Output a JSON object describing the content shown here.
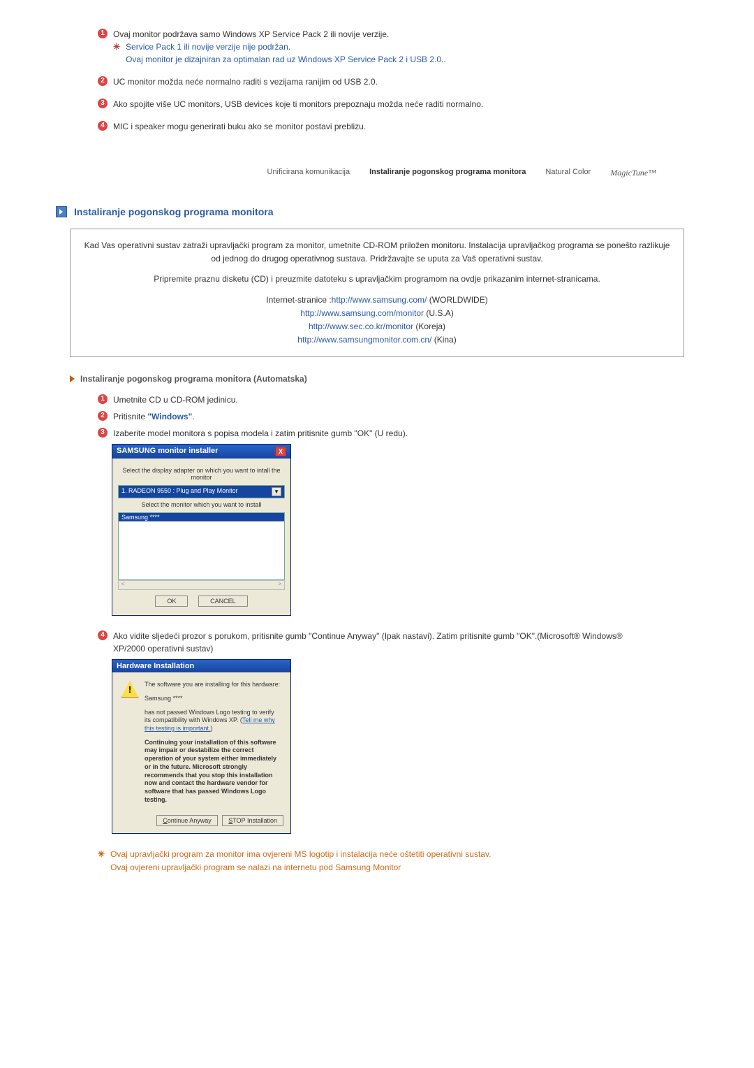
{
  "notes": {
    "n1": "Ovaj monitor podržava samo Windows XP Service Pack 2 ili novije verzije.",
    "n1_sub1": "Service Pack 1 ili novije verzije nije podržan.",
    "n1_sub2": "Ovaj monitor je dizajniran za optimalan rad uz Windows XP Service Pack 2 i USB 2.0..",
    "n2": "UC monitor možda neće normalno raditi s vezijama ranijim od USB 2.0.",
    "n3": "Ako spojite više UC monitors, USB devices koje ti monitors prepoznaju možda neće raditi normalno.",
    "n4": "MIC i speaker mogu generirati buku ako se monitor postavi preblizu."
  },
  "tabs": {
    "t1": "Unificirana komunikacija",
    "t2": "Instaliranje pogonskog programa monitora",
    "t3": "Natural Color",
    "t4": "MagicTune™"
  },
  "section": {
    "title": "Instaliranje pogonskog programa monitora"
  },
  "infobox": {
    "p1": "Kad Vas operativni sustav zatraži upravljački program za monitor, umetnite CD-ROM priložen monitoru. Instalacija upravljačkog programa se ponešto razlikuje od jednog do drugog operativnog sustava. Pridržavajte se uputa za Vaš operativni sustav.",
    "p2": "Pripremite praznu disketu (CD) i preuzmite datoteku s upravljačkim programom na ovdje prikazanim internet-stranicama.",
    "links_label": "Internet-stranice :",
    "l1_url": "http://www.samsung.com/",
    "l1_tag": " (WORLDWIDE)",
    "l2_url": "http://www.samsung.com/monitor",
    "l2_tag": " (U.S.A)",
    "l3_url": "http://www.sec.co.kr/monitor",
    "l3_tag": " (Koreja)",
    "l4_url": "http://www.samsungmonitor.com.cn/",
    "l4_tag": " (Kina)"
  },
  "subhead": "Instaliranje pogonskog programa monitora (Automatska)",
  "steps": {
    "s1": "Umetnite CD u CD-ROM jedinicu.",
    "s2_a": "Pritisnite ",
    "s2_b": "\"Windows\"",
    "s2_c": ".",
    "s3": "Izaberite model monitora s popisa modela i zatim pritisnite gumb \"OK\" (U redu).",
    "s4": "Ako vidite sljedeći prozor s porukom, pritisnite gumb \"Continue Anyway\" (Ipak nastavi). Zatim pritisnite gumb \"OK\".(Microsoft® Windows® XP/2000 operativni sustav)"
  },
  "dlg1": {
    "title": "SAMSUNG monitor installer",
    "lbl1": "Select the display adapter on which you want to intall the monitor",
    "combo": "1. RADEON 9550 : Plug and Play Monitor",
    "lbl2": "Select the monitor which you want to install",
    "item": "Samsung ****",
    "ok": "OK",
    "cancel": "CANCEL"
  },
  "dlg2": {
    "title": "Hardware Installation",
    "p1": "The software you are installing for this hardware:",
    "p2": "Samsung ****",
    "p3a": "has not passed Windows Logo testing to verify its compatibility with Windows XP. (",
    "p3link": "Tell me why this testing is important.",
    "p3b": ")",
    "p4": "Continuing your installation of this software may impair or destabilize the correct operation of your system either immediately or in the future. Microsoft strongly recommends that you stop this installation now and contact the hardware vendor for software that has passed Windows Logo testing.",
    "b1": "Continue Anyway",
    "b2": "STOP Installation"
  },
  "footnote": {
    "l1": "Ovaj upravljački program za monitor ima ovjereni MS logotip i instalacija neće oštetiti operativni sustav.",
    "l2": "Ovaj ovjereni upravljački program se nalazi na internetu pod Samsung Monitor"
  }
}
